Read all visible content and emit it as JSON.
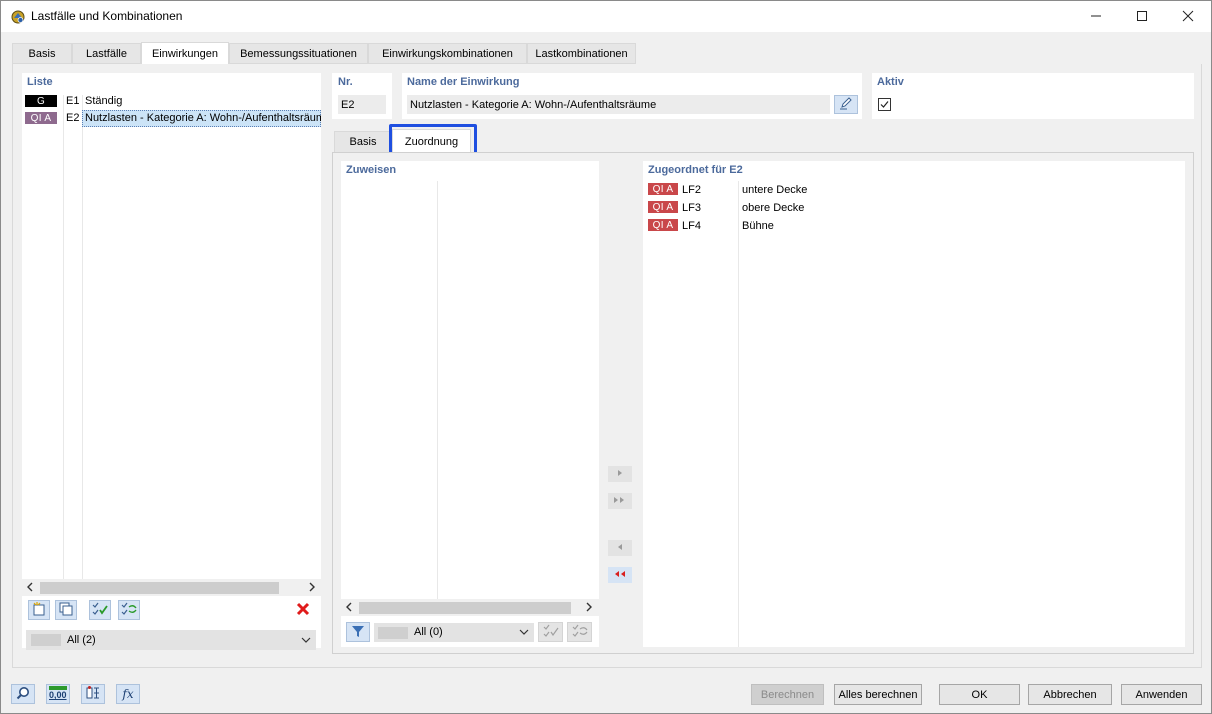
{
  "window": {
    "title": "Lastfälle und Kombinationen",
    "minimize_icon": "minimize-icon",
    "maximize_icon": "maximize-icon",
    "close_icon": "close-icon"
  },
  "main_tabs": [
    "Basis",
    "Lastfälle",
    "Einwirkungen",
    "Bemessungssituationen",
    "Einwirkungskombinationen",
    "Lastkombinationen"
  ],
  "main_tab_active": "Einwirkungen",
  "list": {
    "label": "Liste",
    "items": [
      {
        "badge": "G",
        "badge_color": "#000000",
        "id": "E1",
        "name": "Ständig"
      },
      {
        "badge": "QI A",
        "badge_color": "#8e6a8e",
        "id": "E2",
        "name": "Nutzlasten - Kategorie A: Wohn-/Aufenthaltsräume",
        "selected": true
      }
    ],
    "filter_value": "All (2)"
  },
  "detail": {
    "nr_label": "Nr.",
    "nr_value": "E2",
    "name_label": "Name der Einwirkung",
    "name_value": "Nutzlasten - Kategorie A: Wohn-/Aufenthaltsräume",
    "active_label": "Aktiv",
    "active_checked": true,
    "sub_tabs": [
      "Basis",
      "Zuordnung"
    ],
    "sub_tab_active": "Zuordnung"
  },
  "assign": {
    "label": "Zuweisen",
    "filter_value": "All (0)"
  },
  "assigned": {
    "label": "Zugeordnet für E2",
    "badge_color": "#c9474a",
    "items": [
      {
        "badge": "QI A",
        "id": "LF2",
        "name": "untere Decke"
      },
      {
        "badge": "QI A",
        "id": "LF3",
        "name": "obere Decke"
      },
      {
        "badge": "QI A",
        "id": "LF4",
        "name": "Bühne"
      }
    ]
  },
  "footer": {
    "bottom_icon_1": "search-icon",
    "bottom_icon_2": "units-icon",
    "bottom_icon_2_text": "0,00",
    "bottom_icon_3": "model-icon",
    "bottom_icon_4": "formula-icon",
    "bottom_icon_4_text": "fx",
    "buttons": {
      "berechnen": "Berechnen",
      "alles_berechnen": "Alles berechnen",
      "ok": "OK",
      "abbrechen": "Abbrechen",
      "anwenden": "Anwenden"
    }
  },
  "colors": {
    "accent": "#4c6a9c",
    "selection": "#cce4f7",
    "highlight_border": "#1f4fe0",
    "delete_red": "#e01b1b"
  }
}
